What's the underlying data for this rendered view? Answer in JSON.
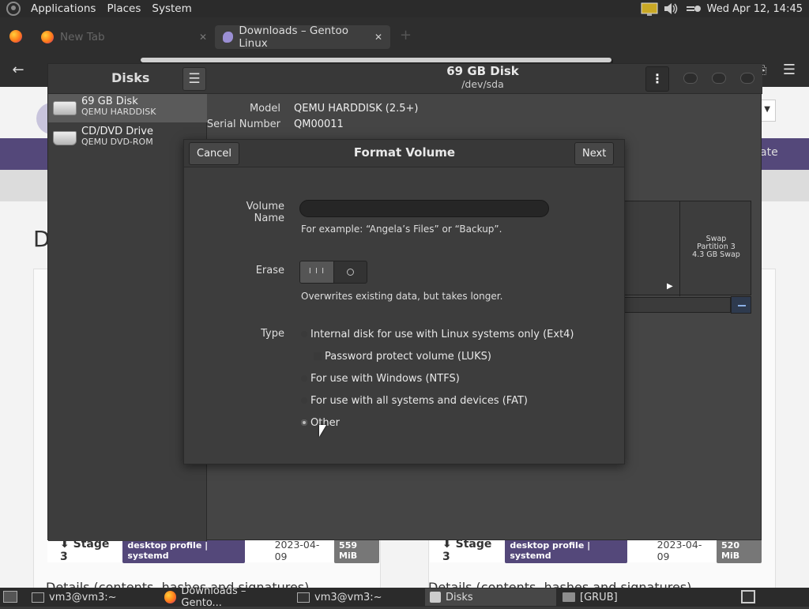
{
  "top_panel": {
    "menus": [
      "Applications",
      "Places",
      "System"
    ],
    "clock": "Wed Apr 12, 14:45"
  },
  "browser": {
    "tabs": [
      {
        "label": "New Tab"
      },
      {
        "label": "Downloads – Gentoo Linux"
      }
    ],
    "page": {
      "heading_initial": "D",
      "banner_partial": "ate",
      "cards": [
        {
          "stage": "Stage 3",
          "profile": "desktop profile | systemd",
          "date": "2023-04-09",
          "size": "559 MiB",
          "details": "Details (contents, hashes and signatures)"
        },
        {
          "stage": "Stage 3",
          "profile": "desktop profile | systemd",
          "date": "2023-04-09",
          "size": "520 MiB",
          "details": "Details (contents, hashes and signatures)"
        }
      ]
    }
  },
  "disks": {
    "title": "Disks",
    "header_title": "69 GB Disk",
    "header_subtitle": "/dev/sda",
    "drives": [
      {
        "name": "69 GB Disk",
        "model": "QEMU HARDDISK"
      },
      {
        "name": "CD/DVD Drive",
        "model": "QEMU DVD-ROM"
      }
    ],
    "info": {
      "model_label": "Model",
      "model_value": "QEMU HARDDISK (2.5+)",
      "serial_label": "Serial Number",
      "serial_value": "QM00011"
    },
    "swap_partition": {
      "line1": "Swap",
      "line2": "Partition 3",
      "line3": "4.3 GB Swap"
    }
  },
  "format_dialog": {
    "title": "Format Volume",
    "cancel_label": "Cancel",
    "next_label": "Next",
    "volume_name_label": "Volume Name",
    "volume_name_value": "",
    "volume_name_hint": "For example: “Angela’s Files” or “Backup”.",
    "erase_label": "Erase",
    "erase_hint": "Overwrites existing data, but takes longer.",
    "type_label": "Type",
    "types": [
      {
        "label": "Internal disk for use with Linux systems only (Ext4)",
        "checked": false
      },
      {
        "label": "For use with Windows (NTFS)",
        "checked": false
      },
      {
        "label": "For use with all systems and devices (FAT)",
        "checked": false
      },
      {
        "label": "Other",
        "checked": true
      }
    ],
    "luks_label": "Password protect volume (LUKS)"
  },
  "taskbar": {
    "tasks": [
      {
        "label": "vm3@vm3:~"
      },
      {
        "label": "Downloads – Gento..."
      },
      {
        "label": "vm3@vm3:~"
      },
      {
        "label": "Disks"
      },
      {
        "label": "[GRUB]"
      }
    ]
  }
}
